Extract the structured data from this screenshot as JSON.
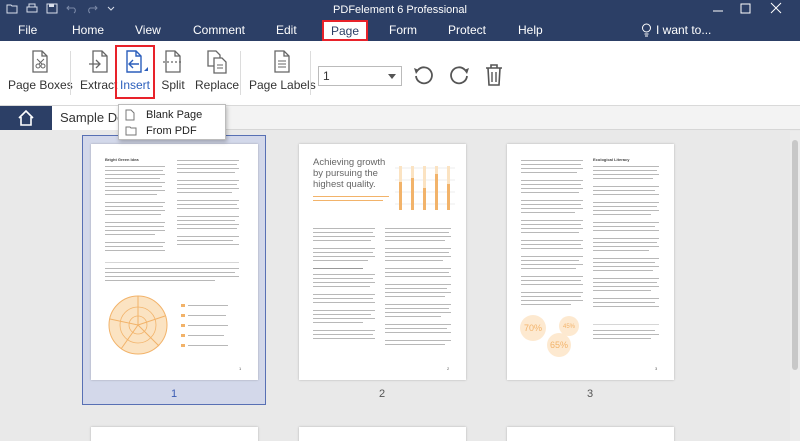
{
  "window": {
    "title": "PDFelement 6 Professional",
    "quick_access_icons": [
      "folder-icon",
      "print-icon",
      "save-icon",
      "undo-icon",
      "redo-icon",
      "dropdown-icon"
    ]
  },
  "menubar": {
    "items": [
      {
        "label": "File"
      },
      {
        "label": "Home"
      },
      {
        "label": "View"
      },
      {
        "label": "Comment"
      },
      {
        "label": "Edit"
      },
      {
        "label": "Page",
        "active": true
      },
      {
        "label": "Form"
      },
      {
        "label": "Protect"
      },
      {
        "label": "Help"
      }
    ],
    "search_placeholder": "I want to..."
  },
  "toolbar": {
    "page_boxes": "Page Boxes",
    "extract": "Extract",
    "insert": "Insert",
    "split": "Split",
    "replace": "Replace",
    "page_labels": "Page Labels",
    "page_select_value": "1",
    "icons": [
      "rotate-left-icon",
      "rotate-right-icon",
      "delete-icon"
    ]
  },
  "insert_menu": {
    "items": [
      {
        "label": "Blank Page",
        "icon": "blank-page-icon"
      },
      {
        "label": "From PDF",
        "icon": "folder-icon"
      }
    ]
  },
  "tabs": {
    "home_icon": "home-icon",
    "doc_tab": "Sample Doc"
  },
  "thumbnails": {
    "pages": [
      {
        "number": "1",
        "selected": true,
        "heading": "Bright Green Idea",
        "footer_num": "1"
      },
      {
        "number": "2",
        "selected": false,
        "heading": "Achieving growth by pursuing the highest quality.",
        "footer_num": "2"
      },
      {
        "number": "3",
        "selected": false,
        "heading": "Ecological Literacy",
        "footer_num": "3",
        "bubbles": [
          "70%",
          "45%",
          "65%"
        ]
      }
    ]
  },
  "colors": {
    "accent_navy": "#2c3f66",
    "highlight_red": "#e8222a",
    "chart_orange": "#f2b36a",
    "selection_blue": "#5870b4"
  }
}
